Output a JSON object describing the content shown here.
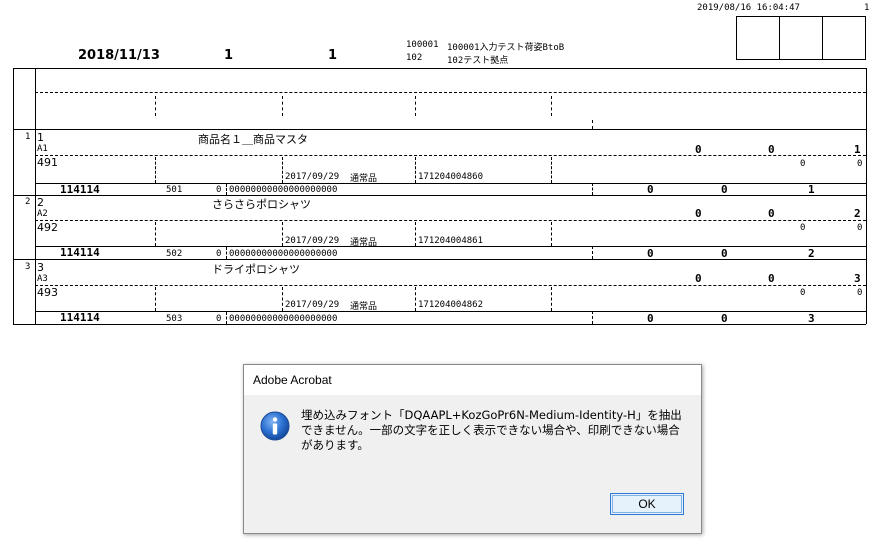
{
  "report": {
    "print_datetime": "2019/08/16 16:04:47",
    "page_number": "1",
    "date": "2018/11/13",
    "header_num_1": "1",
    "header_num_2": "1",
    "shipper_code": "100001",
    "shipper_name": "100001入力テスト荷姿BtoB",
    "warehouse_code": "102",
    "warehouse_name": "102テスト拠点"
  },
  "rows": [
    {
      "row_no": "1",
      "item_no": "1",
      "item_name": "商品名１＿商品マスタ",
      "sub_code": "A1",
      "qty_a": "0",
      "qty_b": "0",
      "qty_c": "1",
      "code_491": "491",
      "small_a": "0",
      "small_b": "0",
      "date": "2017/09/29",
      "type": "通常品",
      "lot": "171204004860",
      "footer_code": "114114",
      "footer_num": "501",
      "footer_zero": "0",
      "barcode": "00000000000000000000",
      "total_a": "0",
      "total_b": "0",
      "total_c": "1"
    },
    {
      "row_no": "2",
      "item_no": "2",
      "item_name": "さらさらポロシャツ",
      "sub_code": "A2",
      "qty_a": "0",
      "qty_b": "0",
      "qty_c": "2",
      "code_491": "492",
      "small_a": "0",
      "small_b": "0",
      "date": "2017/09/29",
      "type": "通常品",
      "lot": "171204004861",
      "footer_code": "114114",
      "footer_num": "502",
      "footer_zero": "0",
      "barcode": "00000000000000000000",
      "total_a": "0",
      "total_b": "0",
      "total_c": "2"
    },
    {
      "row_no": "3",
      "item_no": "3",
      "item_name": "ドライポロシャツ",
      "sub_code": "A3",
      "qty_a": "0",
      "qty_b": "0",
      "qty_c": "3",
      "code_491": "493",
      "small_a": "0",
      "small_b": "0",
      "date": "2017/09/29",
      "type": "通常品",
      "lot": "171204004862",
      "footer_code": "114114",
      "footer_num": "503",
      "footer_zero": "0",
      "barcode": "00000000000000000000",
      "total_a": "0",
      "total_b": "0",
      "total_c": "3"
    }
  ],
  "dialog": {
    "title": "Adobe Acrobat",
    "message": "埋め込みフォント「DQAAPL+KozGoPr6N-Medium-Identity-H」を抽出できません。一部の文字を正しく表示できない場合や、印刷できない場合があります。",
    "ok_label": "OK",
    "icon": "info-icon"
  }
}
